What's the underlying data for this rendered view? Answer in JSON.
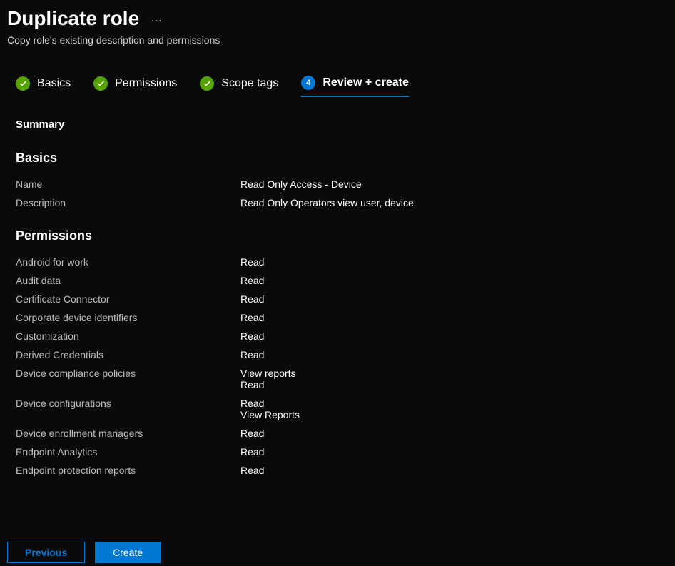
{
  "header": {
    "title": "Duplicate role",
    "subtitle": "Copy role's existing description and permissions"
  },
  "tabs": [
    {
      "label": "Basics",
      "state": "completed"
    },
    {
      "label": "Permissions",
      "state": "completed"
    },
    {
      "label": "Scope tags",
      "state": "completed"
    },
    {
      "label": "Review + create",
      "state": "active",
      "number": "4"
    }
  ],
  "summary": {
    "heading": "Summary",
    "basics": {
      "heading": "Basics",
      "name_label": "Name",
      "name_value": "Read Only Access - Device",
      "description_label": "Description",
      "description_value": "Read Only Operators view user, device."
    },
    "permissions": {
      "heading": "Permissions",
      "items": [
        {
          "label": "Android for work",
          "values": [
            "Read"
          ]
        },
        {
          "label": "Audit data",
          "values": [
            "Read"
          ]
        },
        {
          "label": "Certificate Connector",
          "values": [
            "Read"
          ]
        },
        {
          "label": "Corporate device identifiers",
          "values": [
            "Read"
          ]
        },
        {
          "label": "Customization",
          "values": [
            "Read"
          ]
        },
        {
          "label": "Derived Credentials",
          "values": [
            "Read"
          ]
        },
        {
          "label": "Device compliance policies",
          "values": [
            "View reports",
            "Read"
          ]
        },
        {
          "label": "Device configurations",
          "values": [
            "Read",
            "View Reports"
          ]
        },
        {
          "label": "Device enrollment managers",
          "values": [
            "Read"
          ]
        },
        {
          "label": "Endpoint Analytics",
          "values": [
            "Read"
          ]
        },
        {
          "label": "Endpoint protection reports",
          "values": [
            "Read"
          ]
        }
      ]
    }
  },
  "footer": {
    "previous_label": "Previous",
    "create_label": "Create"
  }
}
